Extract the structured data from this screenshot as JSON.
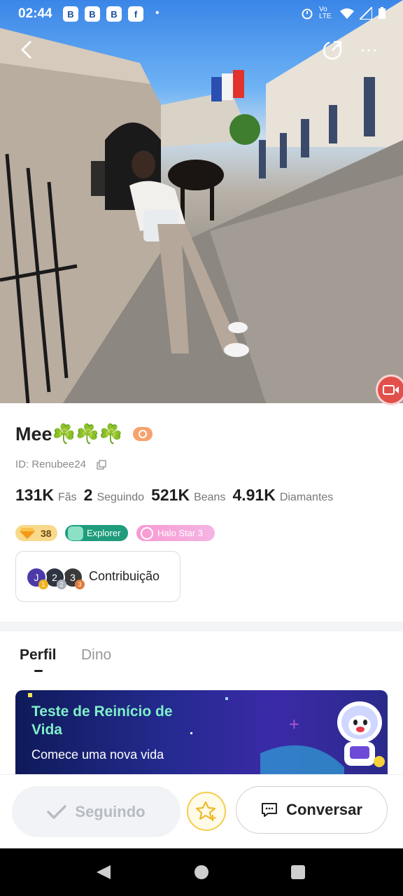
{
  "status_bar": {
    "time": "02:44",
    "app_icons": [
      "B",
      "B",
      "B",
      "f"
    ],
    "network": "Vo LTE"
  },
  "profile": {
    "name": "Mee☘️☘️☘️",
    "id_text": "ID: Renubee24",
    "stats": [
      {
        "value": "131K",
        "label": "Fãs"
      },
      {
        "value": "2",
        "label": "Seguindo"
      },
      {
        "value": "521K",
        "label": "Beans"
      },
      {
        "value": "4.91K",
        "label": "Diamantes"
      }
    ],
    "badges": {
      "level": "38",
      "explorer": "Explorer",
      "halo": "Halo Star 3"
    },
    "contribution": {
      "label": "Contribuição",
      "avatars": [
        {
          "initial": "J",
          "rank": "1",
          "color": "#4b3aa8",
          "rank_color": "#f2b21c"
        },
        {
          "initial": "2",
          "rank": "2",
          "color": "#2e3440",
          "rank_color": "#a9b0b8"
        },
        {
          "initial": "3",
          "rank": "3",
          "color": "#3a3a3a",
          "rank_color": "#e07b3a"
        }
      ]
    }
  },
  "tabs": [
    {
      "label": "Perfil",
      "active": true
    },
    {
      "label": "Dino",
      "active": false
    }
  ],
  "banner": {
    "title": "Teste de Reinício de Vida",
    "subtitle": "Comece uma nova vida"
  },
  "actions": {
    "following_label": "Seguindo",
    "chat_label": "Conversar"
  },
  "colors": {
    "accent_gold": "#f5cd4e",
    "explorer_green": "#1f9c7c",
    "halo_pink": "#f69ad2",
    "live_red": "#e2504b"
  }
}
